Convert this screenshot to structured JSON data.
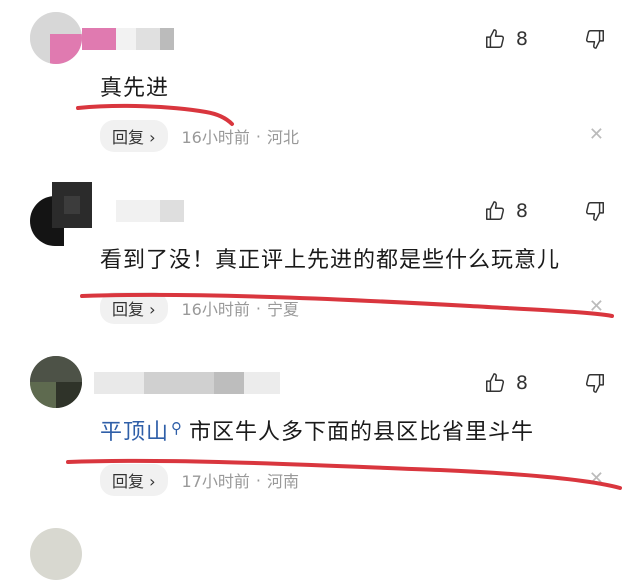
{
  "comments": [
    {
      "text": "真先进",
      "location_prefix": "",
      "likes": "8",
      "reply_label": "回复 ›",
      "time": "16小时前",
      "region": "河北",
      "username": "",
      "separator": "·"
    },
    {
      "text": "看到了没！真正评上先进的都是些什么玩意儿",
      "location_prefix": "",
      "likes": "8",
      "reply_label": "回复 ›",
      "time": "16小时前",
      "region": "宁夏",
      "username": "",
      "separator": "·"
    },
    {
      "text": "市区牛人多下面的县区比省里斗牛",
      "location_prefix": "平顶山",
      "likes": "8",
      "reply_label": "回复 ›",
      "time": "17小时前",
      "region": "河南",
      "username": "",
      "separator": "·"
    }
  ],
  "icons": {
    "like": "thumb-up-icon",
    "dislike": "thumb-down-icon",
    "close": "close-icon",
    "pin": "location-pin-icon"
  },
  "colors": {
    "underline": "#d9363e",
    "place_link": "#2f5fa8",
    "meta": "#999999"
  }
}
